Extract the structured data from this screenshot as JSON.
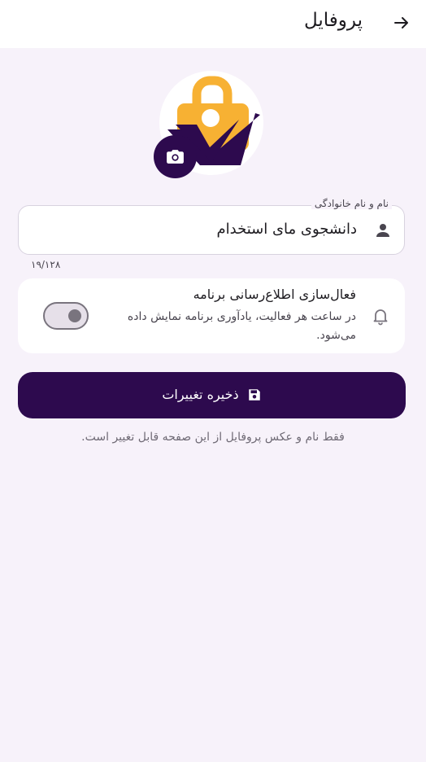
{
  "app_bar": {
    "title": "پروفایل",
    "back_icon": "arrow-forward-icon"
  },
  "avatar": {
    "logo_icon": "briefcase-check-logo",
    "camera_icon": "camera-icon"
  },
  "name_field": {
    "label": "نام و نام خانوادگی",
    "value": "دانشجوی مای استخدام",
    "icon": "person-icon",
    "counter": "۱۹/۱۲۸"
  },
  "notifications": {
    "title": "فعال‌سازی اطلاع‌رسانی برنامه",
    "description": "در ساعت هر فعالیت، یادآوری برنامه نمایش داده می‌شود.",
    "icon": "bell-icon",
    "enabled": false
  },
  "save_button": {
    "label": "ذخیره تغییرات",
    "icon": "save-icon"
  },
  "footnote": "فقط نام و عکس پروفایل از این صفحه قابل تغییر است.",
  "colors": {
    "primary": "#2d0a4e",
    "accent": "#f7b133",
    "background": "#f7f2fa"
  }
}
